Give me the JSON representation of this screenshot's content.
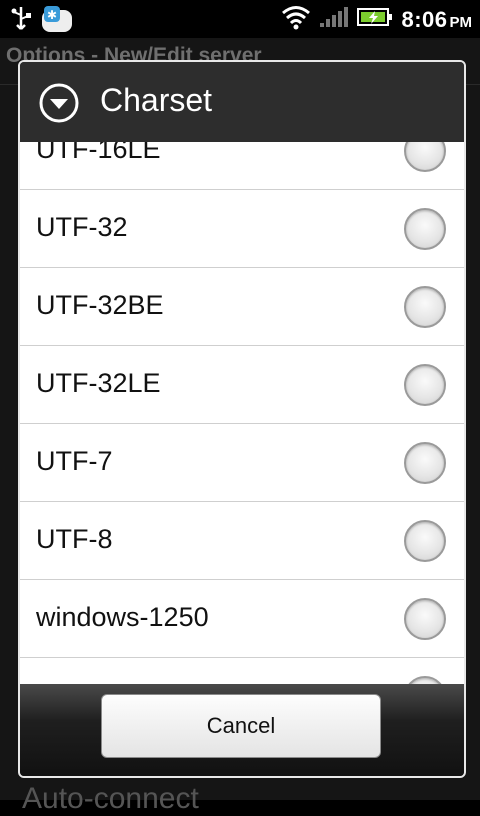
{
  "statusbar": {
    "time": "8:06",
    "ampm": "PM",
    "icons": [
      "usb-icon",
      "notification-app-icon",
      "wifi-icon",
      "signal-icon",
      "battery-charging-icon"
    ]
  },
  "background": {
    "title": "Options - New/Edit server",
    "bottom_label": "Auto-connect"
  },
  "dialog": {
    "title": "Charset",
    "items": [
      {
        "label": "UTF-16LE"
      },
      {
        "label": "UTF-32"
      },
      {
        "label": "UTF-32BE"
      },
      {
        "label": "UTF-32LE"
      },
      {
        "label": "UTF-7"
      },
      {
        "label": "UTF-8"
      },
      {
        "label": "windows-1250"
      }
    ],
    "cancel_label": "Cancel"
  },
  "colors": {
    "dialog_header": "#2d2d2d",
    "list_bg": "#ffffff",
    "divider": "#cfcfcf"
  }
}
